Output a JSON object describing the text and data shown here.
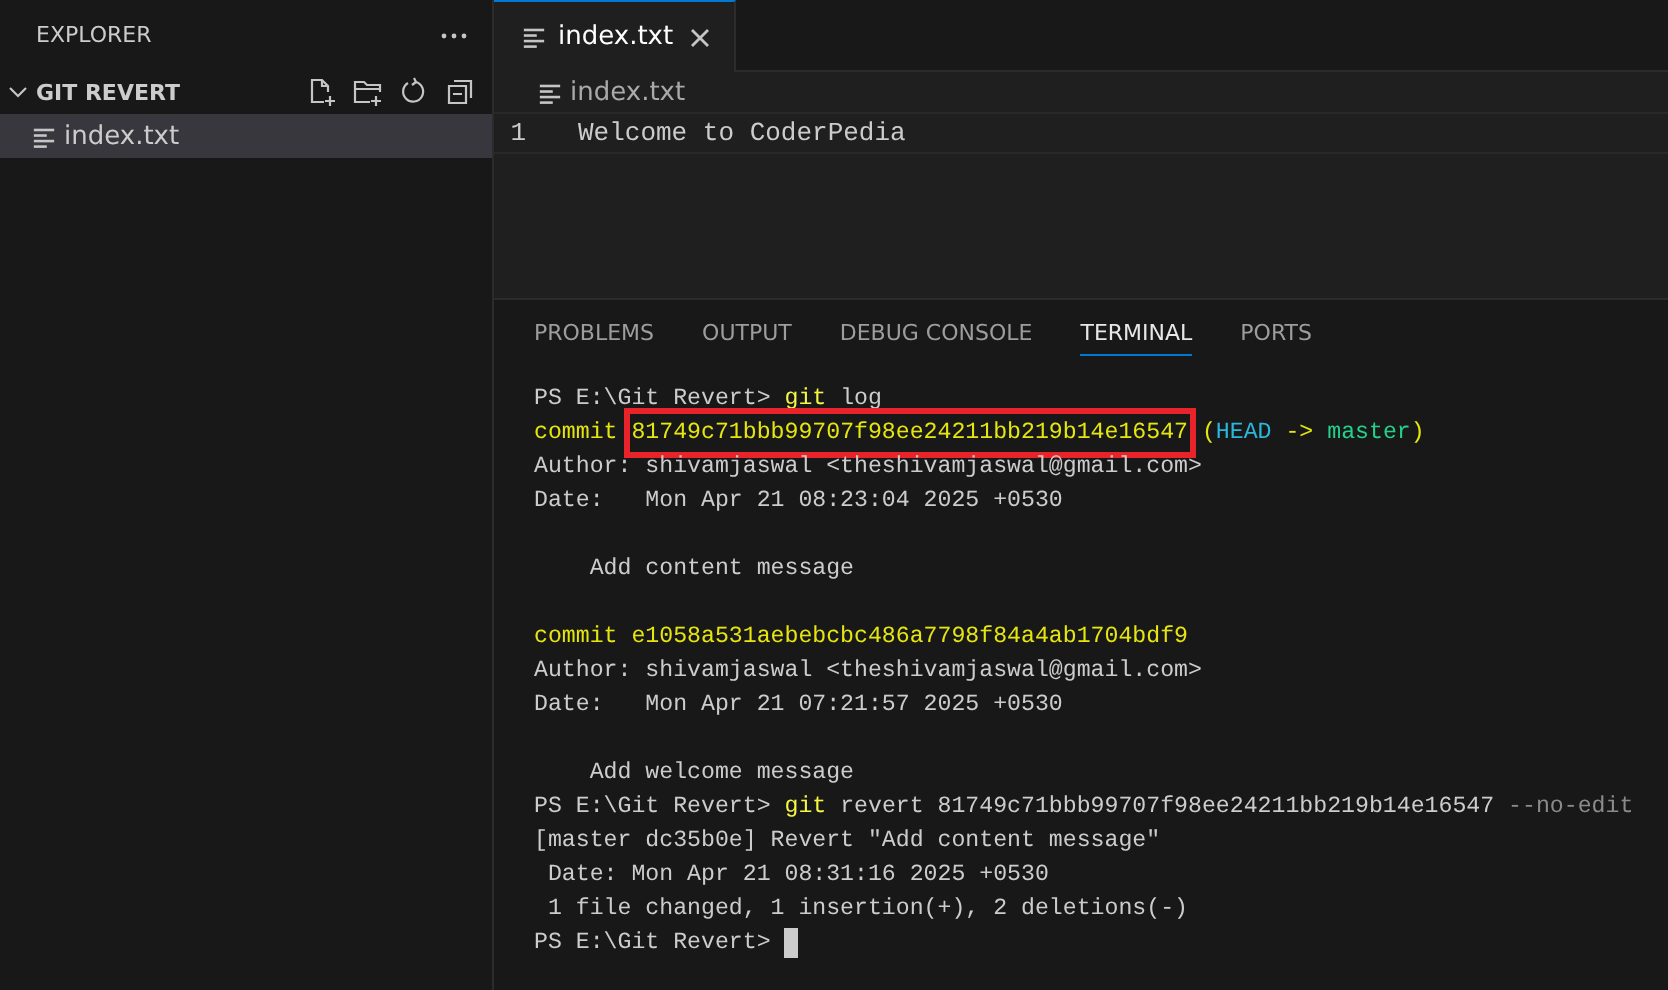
{
  "sidebar": {
    "title": "EXPLORER",
    "folder": {
      "name": "GIT REVERT",
      "expanded": true,
      "files": [
        {
          "name": "index.txt",
          "selected": true
        }
      ]
    }
  },
  "editor": {
    "tabs": [
      {
        "name": "index.txt",
        "selected": true
      }
    ],
    "breadcrumb": "index.txt",
    "lines": [
      {
        "number": "1",
        "text": "Welcome to CoderPedia"
      }
    ]
  },
  "panel": {
    "tabs": [
      {
        "label": "PROBLEMS",
        "selected": false
      },
      {
        "label": "OUTPUT",
        "selected": false
      },
      {
        "label": "DEBUG CONSOLE",
        "selected": false
      },
      {
        "label": "TERMINAL",
        "selected": true
      },
      {
        "label": "PORTS",
        "selected": false
      }
    ],
    "terminal": [
      {
        "kind": "text",
        "segments": [
          {
            "kind": "prompt",
            "text": "PS E:\\Git Revert> "
          },
          {
            "kind": "command",
            "text": "git"
          },
          {
            "kind": "plain",
            "text": " log"
          }
        ]
      },
      {
        "kind": "text",
        "segments": [
          {
            "kind": "commit",
            "text": "commit "
          },
          {
            "kind": "hash",
            "text": "81749c71bbb99707f98ee24211bb219b14e16547",
            "highlighted": true
          },
          {
            "kind": "commit",
            "text": " ("
          },
          {
            "kind": "head",
            "text": "HEAD"
          },
          {
            "kind": "commit",
            "text": " -> "
          },
          {
            "kind": "branch",
            "text": "master"
          },
          {
            "kind": "commit",
            "text": ")"
          }
        ]
      },
      {
        "kind": "text",
        "segments": [
          {
            "kind": "plain",
            "text": "Author: shivamjaswal <theshivamjaswal@gmail.com>"
          }
        ]
      },
      {
        "kind": "text",
        "segments": [
          {
            "kind": "plain",
            "text": "Date:   Mon Apr 21 08:23:04 2025 +0530"
          }
        ]
      },
      {
        "kind": "blank"
      },
      {
        "kind": "text",
        "segments": [
          {
            "kind": "plain",
            "text": "    Add content message"
          }
        ]
      },
      {
        "kind": "blank"
      },
      {
        "kind": "text",
        "segments": [
          {
            "kind": "commit",
            "text": "commit e1058a531aebebcbc486a7798f84a4ab1704bdf9"
          }
        ]
      },
      {
        "kind": "text",
        "segments": [
          {
            "kind": "plain",
            "text": "Author: shivamjaswal <theshivamjaswal@gmail.com>"
          }
        ]
      },
      {
        "kind": "text",
        "segments": [
          {
            "kind": "plain",
            "text": "Date:   Mon Apr 21 07:21:57 2025 +0530"
          }
        ]
      },
      {
        "kind": "blank"
      },
      {
        "kind": "text",
        "segments": [
          {
            "kind": "plain",
            "text": "    Add welcome message"
          }
        ]
      },
      {
        "kind": "text",
        "segments": [
          {
            "kind": "prompt",
            "text": "PS E:\\Git Revert> "
          },
          {
            "kind": "command",
            "text": "git"
          },
          {
            "kind": "plain",
            "text": " revert 81749c71bbb99707f98ee24211bb219b14e16547 "
          },
          {
            "kind": "flag",
            "text": "--no-edit"
          }
        ]
      },
      {
        "kind": "text",
        "segments": [
          {
            "kind": "plain",
            "text": "[master dc35b0e] Revert \"Add content message\""
          }
        ]
      },
      {
        "kind": "text",
        "segments": [
          {
            "kind": "plain",
            "text": " Date: Mon Apr 21 08:31:16 2025 +0530"
          }
        ]
      },
      {
        "kind": "text",
        "segments": [
          {
            "kind": "plain",
            "text": " 1 file changed, 1 insertion(+), 2 deletions(-)"
          }
        ]
      },
      {
        "kind": "text",
        "cursor": true,
        "segments": [
          {
            "kind": "prompt",
            "text": "PS E:\\Git Revert> "
          }
        ]
      }
    ]
  }
}
